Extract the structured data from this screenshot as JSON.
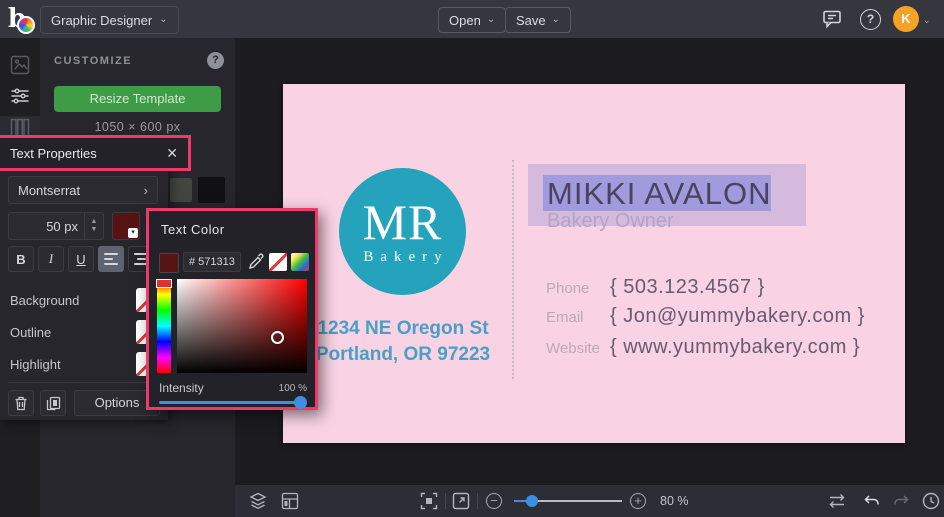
{
  "colors": {
    "accent_highlight": "#ee3a6b",
    "resize_green": "#3e9c47",
    "card_pink": "#f9d2e3",
    "logo_teal": "#25a3bd",
    "address_teal": "#48a0c6",
    "avatar_orange": "#f5a226",
    "text_color_value": "#571313",
    "slider_blue": "#3d8fe4",
    "selection_blue": "rgba(116,129,219,0.55)"
  },
  "icons": [
    "befunky-logo",
    "chevron-down-icon",
    "chat-icon",
    "help-icon",
    "image-icon",
    "adjust-sliders-icon",
    "columns-icon",
    "question-icon",
    "close-icon",
    "chevron-right-icon",
    "stepper-up-icon",
    "stepper-down-icon",
    "align-left-icon",
    "align-center-icon",
    "none-color-icon",
    "trash-icon",
    "duplicate-icon",
    "eyedropper-icon",
    "rainbow-swatch-icon",
    "layers-icon",
    "template-manager-icon",
    "fit-screen-icon",
    "fullscreen-icon",
    "zoom-out-icon",
    "zoom-in-icon",
    "compare-icon",
    "undo-icon",
    "redo-icon",
    "history-icon"
  ],
  "topbar": {
    "app_menu": "Graphic Designer",
    "open_label": "Open",
    "save_label": "Save",
    "avatar_initial": "K"
  },
  "customize": {
    "title": "CUSTOMIZE",
    "help": "?",
    "resize_button": "Resize Template",
    "dimensions": "1050 × 600 px"
  },
  "text_properties": {
    "title": "Text Properties",
    "close": "✕",
    "font_name": "Montserrat",
    "font_size": "50 px",
    "bold": "B",
    "italic": "I",
    "underline": "U",
    "background_label": "Background",
    "outline_label": "Outline",
    "highlight_label": "Highlight",
    "options_label": "Options"
  },
  "color_picker": {
    "title": "Text Color",
    "hex": "# 571313",
    "intensity_label": "Intensity",
    "intensity_value": "100 %"
  },
  "card": {
    "logo_initials": "MR",
    "logo_sub": "Bakery",
    "address_line1": "1234 NE Oregon St",
    "address_line2": "Portland, OR 97223",
    "name": "MIKKI AVALON",
    "role": "Bakery Owner",
    "contacts": [
      {
        "label": "Phone",
        "value": "{ 503.123.4567 }"
      },
      {
        "label": "Email",
        "value": "{ Jon@yummybakery.com }"
      },
      {
        "label": "Website",
        "value": "{ www.yummybakery.com }"
      }
    ]
  },
  "toolbar": {
    "zoom_value": "80 %"
  }
}
